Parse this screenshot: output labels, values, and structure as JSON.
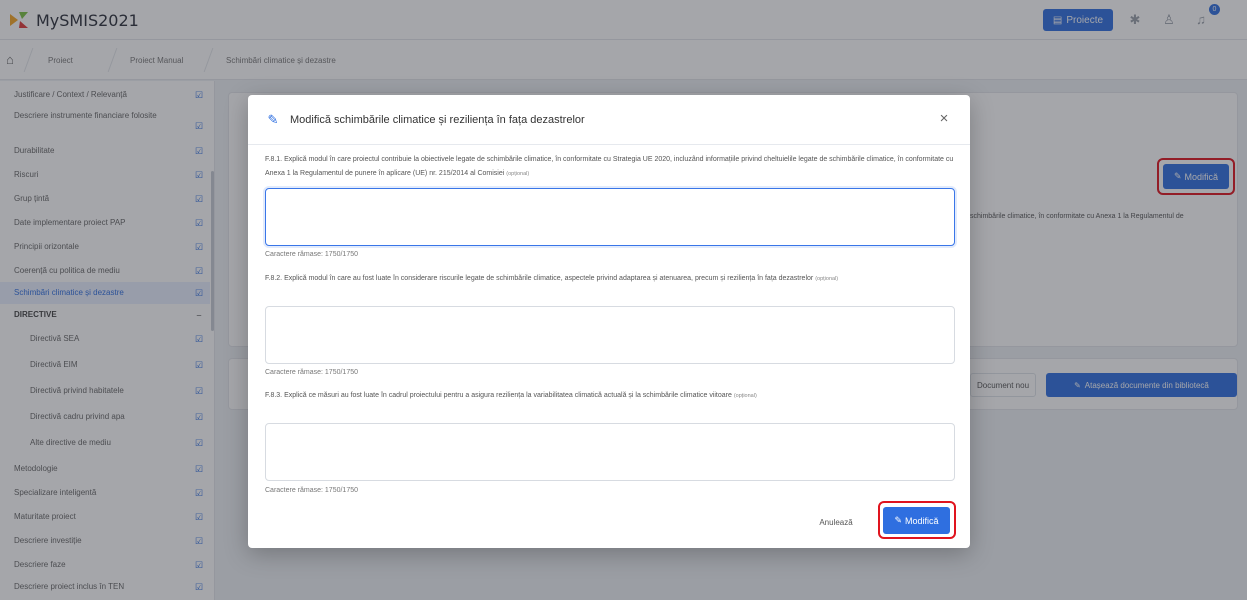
{
  "app": {
    "title": "MySMIS2021"
  },
  "header": {
    "projects_label": "Proiecte",
    "notification_count": "0"
  },
  "breadcrumb": {
    "items": [
      "Proiect",
      "Proiect Manual",
      "Schimbări climatice și dezastre"
    ]
  },
  "sidebar": {
    "items": [
      {
        "label": "Justificare / Context / Relevanță"
      },
      {
        "label": "Descriere instrumente financiare folosite"
      },
      {
        "label": "Durabilitate"
      },
      {
        "label": "Riscuri"
      },
      {
        "label": "Grup țintă"
      },
      {
        "label": "Date implementare proiect PAP"
      },
      {
        "label": "Principii orizontale"
      },
      {
        "label": "Coerență cu politica de mediu"
      },
      {
        "label": "Schimbări climatice și dezastre"
      },
      {
        "label": "DIRECTIVE"
      },
      {
        "label": "Directivă SEA"
      },
      {
        "label": "Directivă EIM"
      },
      {
        "label": "Directivă privind habitatele"
      },
      {
        "label": "Directivă cadru privind apa"
      },
      {
        "label": "Alte directive de mediu"
      },
      {
        "label": "Metodologie"
      },
      {
        "label": "Specializare inteligentă"
      },
      {
        "label": "Maturitate proiect"
      },
      {
        "label": "Descriere investiție"
      },
      {
        "label": "Descriere faze"
      },
      {
        "label": "Descriere proiect inclus în TEN"
      }
    ]
  },
  "background": {
    "modifica_label": "Modifică",
    "truncated_text": "schimbările climatice, în conformitate cu Anexa 1 la Regulamentul de",
    "new_document_label": "Document nou",
    "attach_label": "Atașează documente din bibliotecă"
  },
  "modal": {
    "title": "Modifică schimbările climatice și reziliența în fața dezastrelor",
    "questions": [
      {
        "text": "F.8.1. Explică modul în care proiectul contribuie la obiectivele legate de schimbările climatice, în conformitate cu Strategia UE 2020, incluzând informațiile privind cheltuielile legate de schimbările climatice, în conformitate cu Anexa 1 la Regulamentul de punere în aplicare (UE) nr. 215/2014 al Comisiei",
        "optional": "(opțional)",
        "value": "",
        "counter": "Caractere rămase: 1750/1750"
      },
      {
        "text": "F.8.2. Explică modul în care au fost luate în considerare riscurile legate de schimbările climatice, aspectele privind adaptarea și atenuarea, precum și reziliența în fața dezastrelor",
        "optional": "(opțional)",
        "value": "",
        "counter": "Caractere rămase: 1750/1750"
      },
      {
        "text": "F.8.3. Explică ce măsuri au fost luate în cadrul proiectului pentru a asigura reziliența la variabilitatea climatică actuală și la schimbările climatice viitoare",
        "optional": "(opțional)",
        "value": "",
        "counter": "Caractere rămase: 1750/1750"
      }
    ],
    "cancel_label": "Anulează",
    "save_label": "Modifică"
  },
  "colors": {
    "accent": "#2f6fe0",
    "highlight": "#e0141e"
  }
}
